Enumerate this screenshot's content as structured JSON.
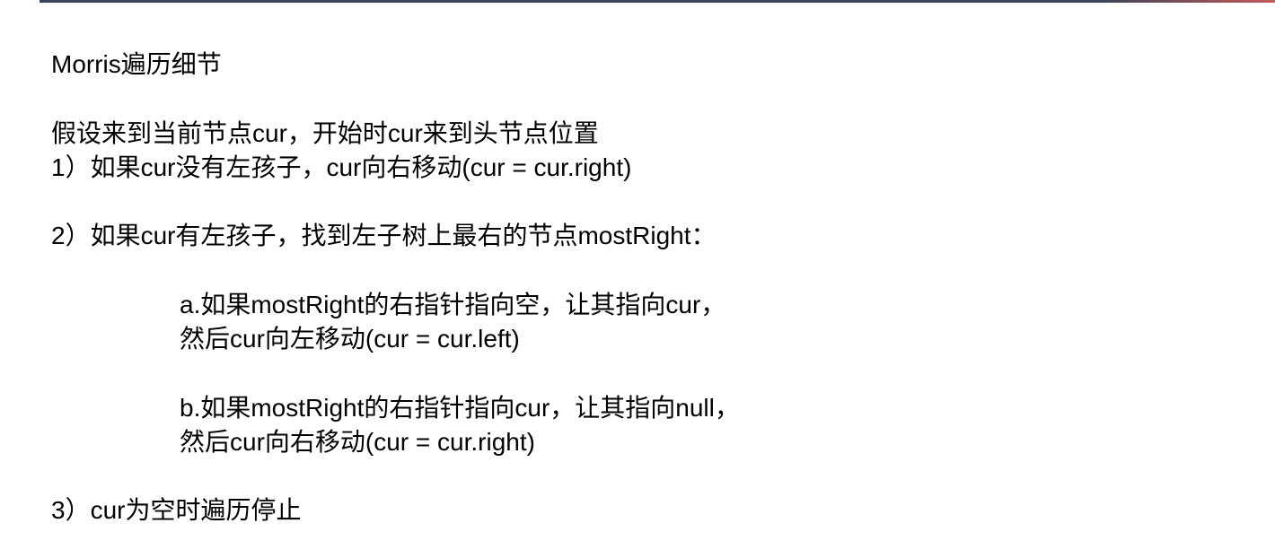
{
  "slide": {
    "title": "Morris遍历细节",
    "intro": "假设来到当前节点cur，开始时cur来到头节点位置",
    "rule1": "1）如果cur没有左孩子，cur向右移动(cur = cur.right)",
    "rule2": "2）如果cur有左孩子，找到左子树上最右的节点mostRight：",
    "rule2a_line1": "a.如果mostRight的右指针指向空，让其指向cur，",
    "rule2a_line2": "然后cur向左移动(cur = cur.left)",
    "rule2b_line1": "b.如果mostRight的右指针指向cur，让其指向null，",
    "rule2b_line2": "然后cur向右移动(cur = cur.right)",
    "rule3": "3）cur为空时遍历停止"
  }
}
